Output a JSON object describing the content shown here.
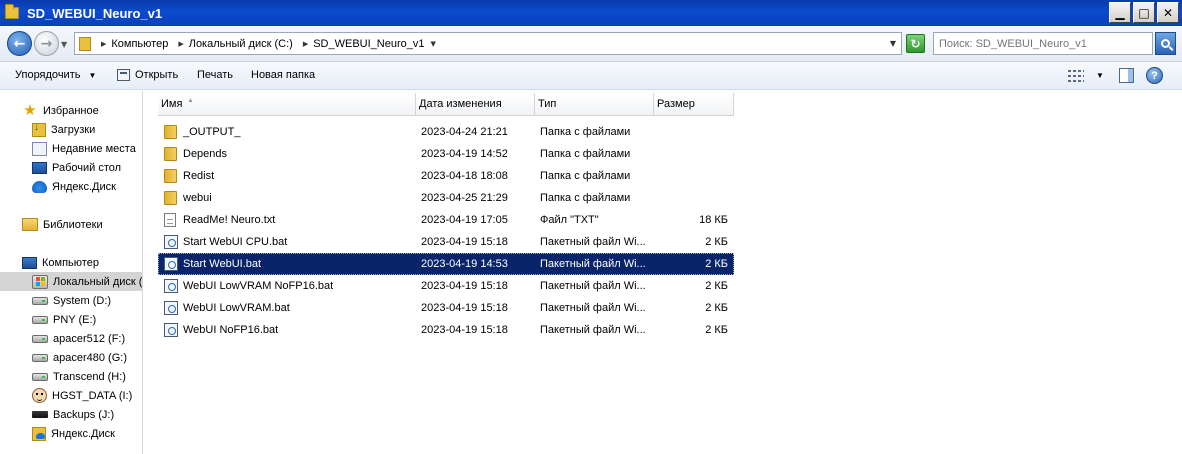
{
  "window": {
    "title": "SD_WEBUI_Neuro_v1"
  },
  "address": {
    "crumbs": [
      "Компьютер",
      "Локальный диск (C:)",
      "SD_WEBUI_Neuro_v1"
    ],
    "search_placeholder": "Поиск: SD_WEBUI_Neuro_v1"
  },
  "toolbar": {
    "organize": "Упорядочить",
    "open": "Открыть",
    "print": "Печать",
    "new_folder": "Новая папка"
  },
  "sidebar": {
    "favorites": {
      "title": "Избранное",
      "items": [
        "Загрузки",
        "Недавние места",
        "Рабочий стол",
        "Яндекс.Диск"
      ]
    },
    "libraries": {
      "title": "Библиотеки"
    },
    "computer": {
      "title": "Компьютер",
      "items": [
        "Локальный диск (",
        "System (D:)",
        "PNY (E:)",
        "apacer512 (F:)",
        "apacer480 (G:)",
        "Transcend (H:)",
        "HGST_DATA (I:)",
        "Backups (J:)",
        "Яндекс.Диск"
      ],
      "selected_index": 0
    }
  },
  "filelist": {
    "columns": {
      "name": "Имя",
      "date": "Дата изменения",
      "type": "Тип",
      "size": "Размер"
    },
    "selected_index": 6,
    "rows": [
      {
        "kind": "folder",
        "name": "_OUTPUT_",
        "date": "2023-04-24 21:21",
        "type": "Папка с файлами",
        "size": ""
      },
      {
        "kind": "folder",
        "name": "Depends",
        "date": "2023-04-19 14:52",
        "type": "Папка с файлами",
        "size": ""
      },
      {
        "kind": "folder",
        "name": "Redist",
        "date": "2023-04-18 18:08",
        "type": "Папка с файлами",
        "size": ""
      },
      {
        "kind": "folder",
        "name": "webui",
        "date": "2023-04-25 21:29",
        "type": "Папка с файлами",
        "size": ""
      },
      {
        "kind": "txt",
        "name": "ReadMe! Neuro.txt",
        "date": "2023-04-19 17:05",
        "type": "Файл \"TXT\"",
        "size": "18 КБ"
      },
      {
        "kind": "bat",
        "name": "Start WebUI CPU.bat",
        "date": "2023-04-19 15:18",
        "type": "Пакетный файл Wi...",
        "size": "2 КБ"
      },
      {
        "kind": "bat",
        "name": "Start WebUI.bat",
        "date": "2023-04-19 14:53",
        "type": "Пакетный файл Wi...",
        "size": "2 КБ"
      },
      {
        "kind": "bat",
        "name": "WebUI LowVRAM NoFP16.bat",
        "date": "2023-04-19 15:18",
        "type": "Пакетный файл Wi...",
        "size": "2 КБ"
      },
      {
        "kind": "bat",
        "name": "WebUI LowVRAM.bat",
        "date": "2023-04-19 15:18",
        "type": "Пакетный файл Wi...",
        "size": "2 КБ"
      },
      {
        "kind": "bat",
        "name": "WebUI NoFP16.bat",
        "date": "2023-04-19 15:18",
        "type": "Пакетный файл Wi...",
        "size": "2 КБ"
      }
    ]
  }
}
